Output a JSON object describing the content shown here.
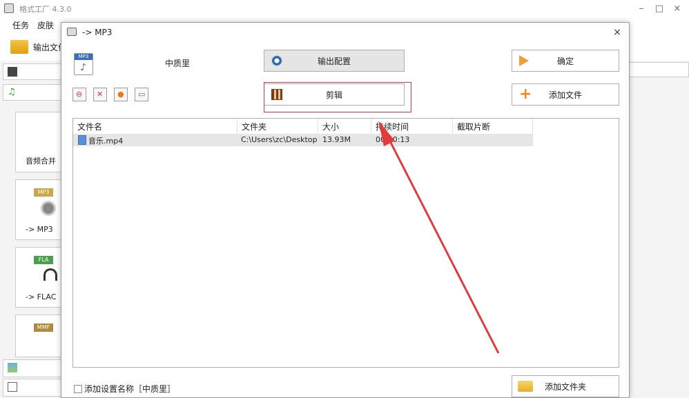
{
  "app": {
    "title": "格式工厂 4.3.0",
    "minimize": "–",
    "maximize": "□",
    "close": "×"
  },
  "menu": {
    "items": [
      "任务",
      "皮肤"
    ]
  },
  "toolbar": {
    "output_folder_label": "输出文件"
  },
  "categories": [
    {
      "label": "音频合并"
    },
    {
      "label": "-> MP3",
      "tag": "MP3"
    },
    {
      "label": "-> FLAC",
      "tag": "FLA"
    },
    {
      "label": "",
      "tag": "MMF"
    }
  ],
  "dialog": {
    "title": "-> MP3",
    "close": "×",
    "format_icon_tag": "MP3",
    "quality": "中质里",
    "output_config_button": "输出配置",
    "edit_button": "剪辑",
    "ok_button": "确定",
    "add_file_button": "添加文件",
    "add_folder_button": "添加文件夹",
    "add_setting_name_label": "添加设置名称［中质里］",
    "table": {
      "columns": [
        "文件名",
        "文件夹",
        "大小",
        "持续时间",
        "截取片断"
      ],
      "rows": [
        {
          "name": "音乐.mp4",
          "folder": "C:\\Users\\zc\\Desktop",
          "size": "13.93M",
          "duration": "00:00:13",
          "clip": ""
        }
      ]
    }
  },
  "colors": {
    "highlight_box": "#d23b3b",
    "annotation_arrow": "#e23b3b"
  }
}
